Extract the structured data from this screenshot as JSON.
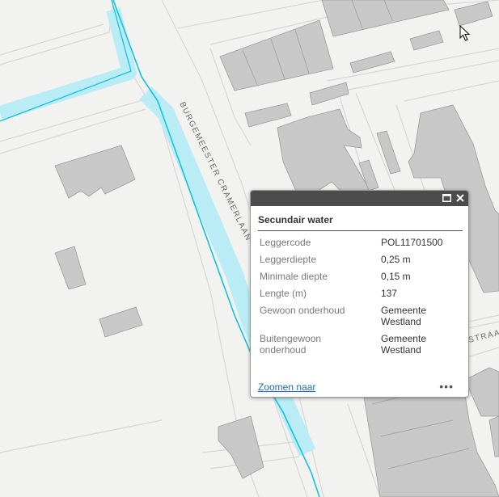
{
  "map": {
    "street_label_1": "BURGEMEESTER CRAMERLAAN",
    "street_label_2": "STRAAT",
    "colors": {
      "background": "#f2f2f0",
      "building_roof": "#c8c8c8",
      "building_side": "#a9a9a9",
      "road_edge": "#d6d6d3",
      "water_highlight": "#b9ecf5",
      "water_line": "#16c2e0"
    }
  },
  "popup": {
    "title": "Secundair water",
    "maximize_icon": "maximize-icon",
    "close_icon": "close-icon",
    "attributes": [
      {
        "key": "Leggercode",
        "value": "POL11701500"
      },
      {
        "key": "Leggerdiepte",
        "value": "0,25 m"
      },
      {
        "key": "Minimale diepte",
        "value": "0,15 m"
      },
      {
        "key": "Lengte (m)",
        "value": "137"
      },
      {
        "key": "Gewoon onderhoud",
        "value": "Gemeente Westland"
      },
      {
        "key": "Buitengewoon onderhoud",
        "value": "Gemeente Westland"
      }
    ],
    "zoom_link": "Zoomen naar",
    "more_label": "•••"
  }
}
